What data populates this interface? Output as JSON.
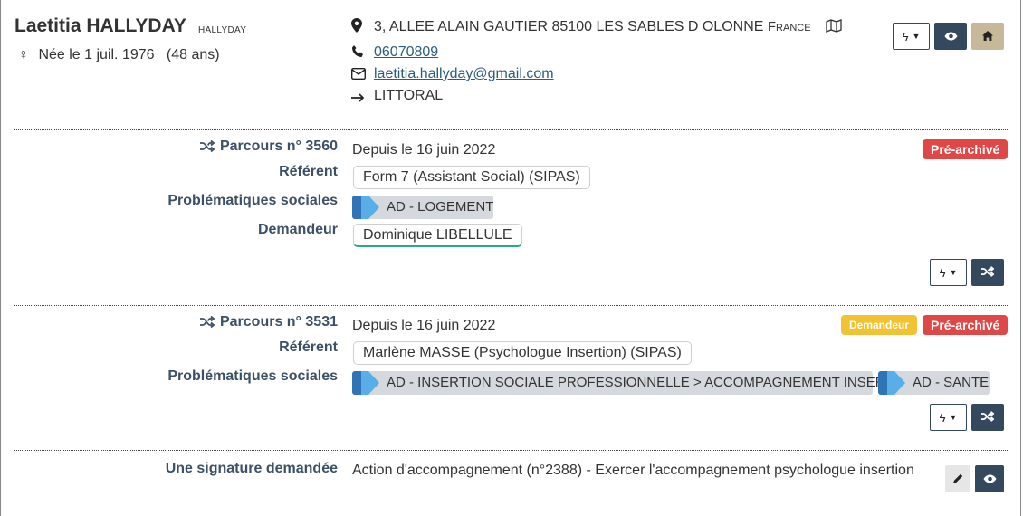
{
  "person": {
    "full_name": "Laetitia HALLYDAY",
    "small_name": "HALLYDAY",
    "gender_symbol": "♀",
    "birth": "Née le 1 juil. 1976",
    "age": "(48 ans)"
  },
  "contact": {
    "address": "3, ALLEE ALAIN GAUTIER 85100 LES SABLES D OLONNE",
    "country": "France",
    "phone": "06070809",
    "email": "laetitia.hallyday@gmail.com",
    "territory": "LITTORAL",
    "icons": [
      "map-pin-icon",
      "map-icon",
      "phone-icon",
      "envelope-icon",
      "arrow-right-icon"
    ]
  },
  "header_buttons": [
    "actions-dropdown",
    "view",
    "home"
  ],
  "parcours": [
    {
      "title": "Parcours n° 3560",
      "since": "Depuis le 16 juin 2022",
      "badges": [
        {
          "text": "Pré-archivé",
          "color": "#e04848"
        }
      ],
      "referent_label": "Référent",
      "referent": "Form 7 (Assistant Social) (SIPAS)",
      "problematiques_label": "Problématiques sociales",
      "problematiques": [
        "AD - LOGEMENT"
      ],
      "demandeur_label": "Demandeur",
      "demandeur": "Dominique LIBELLULE"
    },
    {
      "title": "Parcours n° 3531",
      "since": "Depuis le 16 juin 2022",
      "badges": [
        {
          "text": "Demandeur",
          "color": "#f1c232"
        },
        {
          "text": "Pré-archivé",
          "color": "#e04848"
        }
      ],
      "referent_label": "Référent",
      "referent": "Marlène MASSE (Psychologue Insertion) (SIPAS)",
      "problematiques_label": "Problématiques sociales",
      "problematiques": [
        "AD - INSERTION SOCIALE PROFESSIONNELLE > ACCOMPAGNEMENT INSERTION",
        "AD - SANTE"
      ]
    }
  ],
  "signature": {
    "label": "Une signature demandée",
    "text": "Action d'accompagnement (n°2388) - Exercer l'accompagnement psychologue insertion"
  }
}
